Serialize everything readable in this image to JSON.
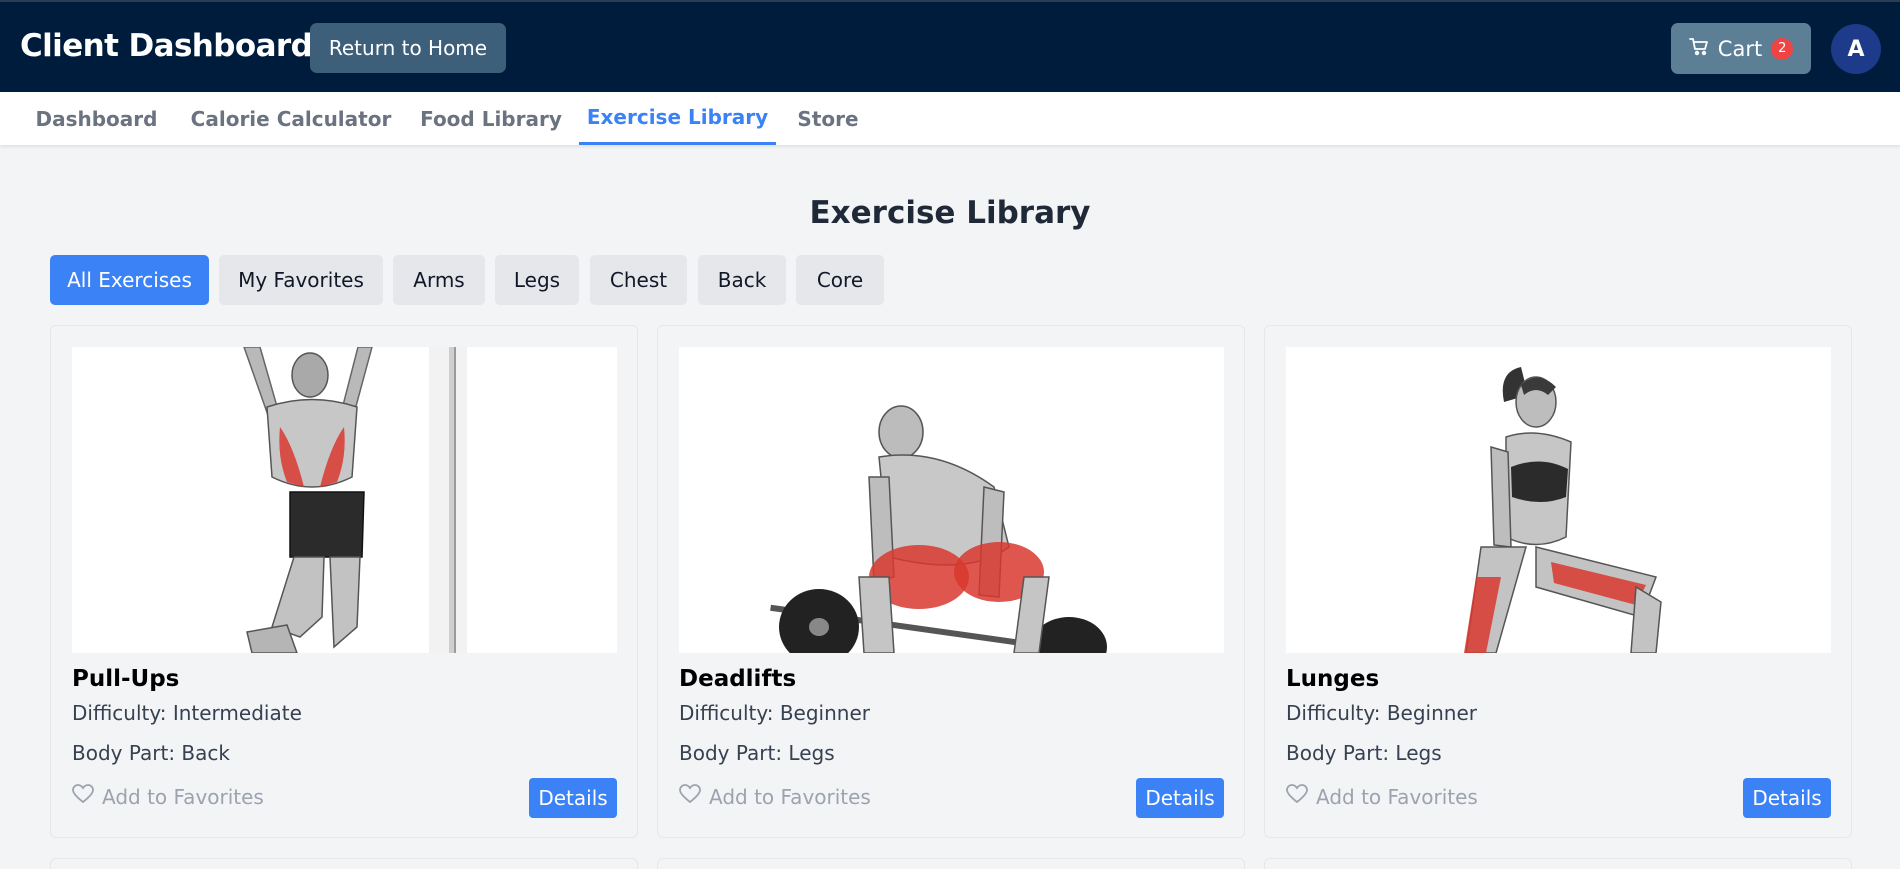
{
  "header": {
    "title": "Client Dashboard",
    "home_label": "Return to Home",
    "cart_label": "Cart",
    "cart_count": "2",
    "avatar_letter": "A"
  },
  "tabs": [
    {
      "label": "Dashboard",
      "active": false
    },
    {
      "label": "Calorie Calculator",
      "active": false
    },
    {
      "label": "Food Library",
      "active": false
    },
    {
      "label": "Exercise Library",
      "active": true
    },
    {
      "label": "Store",
      "active": false
    }
  ],
  "page_title": "Exercise Library",
  "filters": [
    {
      "label": "All Exercises",
      "active": true
    },
    {
      "label": "My Favorites",
      "active": false
    },
    {
      "label": "Arms",
      "active": false
    },
    {
      "label": "Legs",
      "active": false
    },
    {
      "label": "Chest",
      "active": false
    },
    {
      "label": "Back",
      "active": false
    },
    {
      "label": "Core",
      "active": false
    }
  ],
  "exercises": [
    {
      "name": "Pull-Ups",
      "difficulty": "Difficulty: Intermediate",
      "body_part": "Body Part: Back",
      "favorite_label": "Add to Favorites",
      "details_label": "Details"
    },
    {
      "name": "Deadlifts",
      "difficulty": "Difficulty: Beginner",
      "body_part": "Body Part: Legs",
      "favorite_label": "Add to Favorites",
      "details_label": "Details"
    },
    {
      "name": "Lunges",
      "difficulty": "Difficulty: Beginner",
      "body_part": "Body Part: Legs",
      "favorite_label": "Add to Favorites",
      "details_label": "Details"
    }
  ],
  "colors": {
    "header_bg": "#001c3d",
    "accent": "#3b82f6",
    "badge": "#ef4444",
    "muscle_highlight": "#d8382e"
  },
  "icons": {
    "cart": "cart-icon",
    "favorite": "heart-icon"
  }
}
